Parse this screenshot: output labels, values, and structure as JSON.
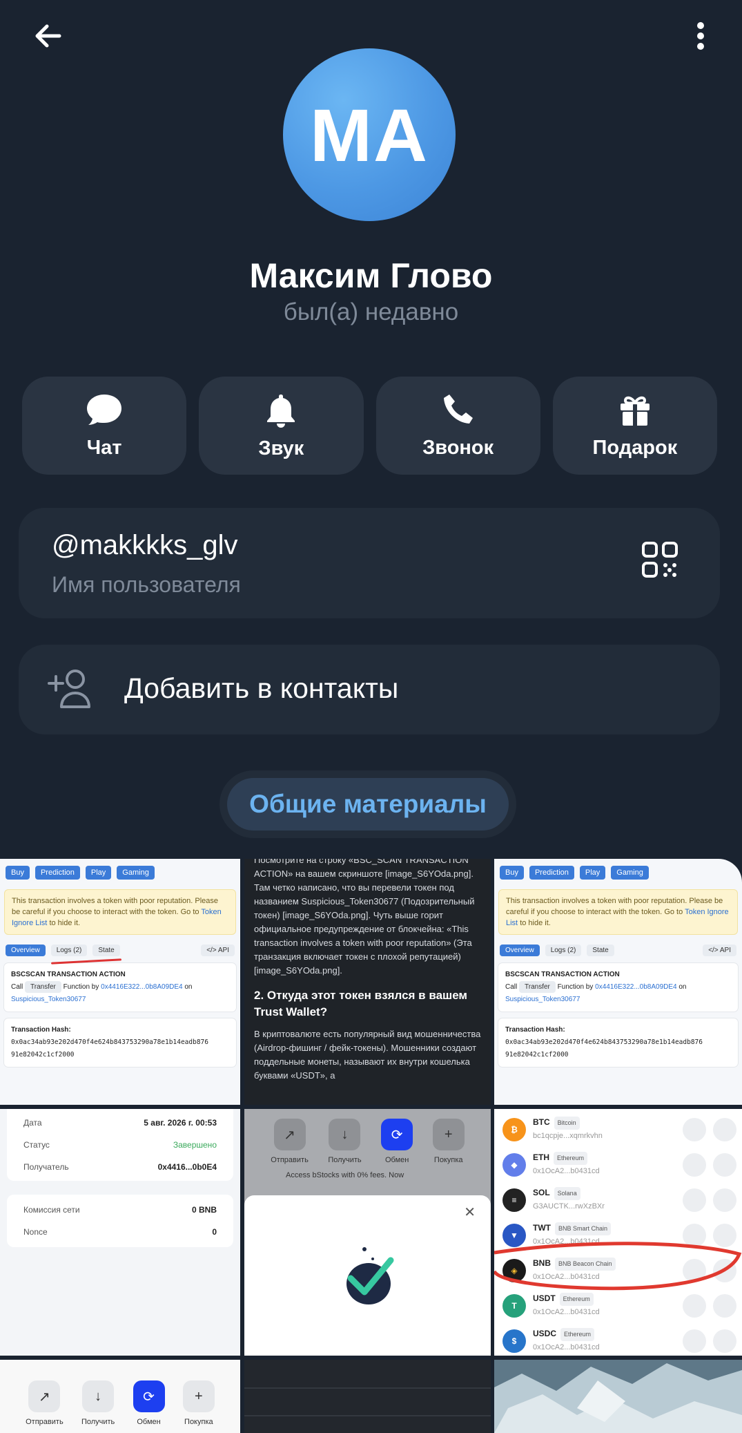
{
  "header": {
    "back_icon": "arrow-left-icon",
    "menu_icon": "more-vertical-icon"
  },
  "profile": {
    "initials": "МА",
    "name": "Максим Глово",
    "status": "был(а) недавно",
    "avatar_color": "#4d98e4"
  },
  "actions": [
    {
      "label": "Чат",
      "icon": "chat-bubble-icon"
    },
    {
      "label": "Звук",
      "icon": "bell-icon"
    },
    {
      "label": "Звонок",
      "icon": "phone-icon"
    },
    {
      "label": "Подарок",
      "icon": "gift-icon"
    }
  ],
  "username": {
    "value": "@makkkks_glv",
    "label": "Имя пользователя",
    "icon": "qr-code-icon"
  },
  "add_contact": {
    "label": "Добавить в контакты",
    "icon": "add-person-icon"
  },
  "media_tab": {
    "label": "Общие материалы",
    "accent": "#6cb3f0"
  },
  "media": {
    "bscscan": {
      "menu": [
        "Buy",
        "Prediction",
        "Play",
        "Gaming"
      ],
      "warning": "This transaction involves a token with poor reputation. Please be careful if you choose to interact with the token.",
      "warning_go": "Go to",
      "warning_link": "Token Ignore List",
      "warning_end": "to hide it.",
      "tabs": [
        "Overview",
        "Logs (2)",
        "State"
      ],
      "api": "</> API",
      "action_title": "BSCSCAN TRANSACTION ACTION",
      "call": "Call",
      "call_tag": "Transfer",
      "function_by": "Function by",
      "function_addr": "0x4416E322...0b8A09DE4",
      "on": "on",
      "token": "Suspicious_Token30677",
      "hash_title": "Transaction Hash:",
      "hash": "0x0ac34ab93e202d470f4e624b843753290a78e1b14eadb876 91e82042c1cf2000"
    },
    "article": {
      "p1": "Посмотрите на строку «BSC_SCAN TRANSACTION ACTION» на вашем скриншоте [image_S6YOda.png]. Там четко написано, что вы перевели токен под названием Suspicious_Token30677 (Подозрительный токен) [image_S6YOda.png]. Чуть выше горит официальное предупреждение от блокчейна: «This transaction involves a token with poor reputation» (Эта транзакция включает токен с плохой репутацией) [image_S6YOda.png].",
      "h2": "2. Откуда этот токен взялся в вашем Trust Wallet?",
      "p2": "В криптовалюте есть популярный вид мошенничества (Airdrop-фишинг / фейк-токены). Мошенники создают поддельные монеты, называют их внутри кошелька буквами «USDT», а"
    },
    "details": {
      "rows": [
        {
          "k": "Дата",
          "v": "5 авг. 2026 г. 00:53"
        },
        {
          "k": "Статус",
          "v": "Завершено"
        },
        {
          "k": "Получатель",
          "v": "0x4416...0b0E4"
        }
      ],
      "rows2": [
        {
          "k": "Комиссия сети",
          "v": "0 BNB"
        },
        {
          "k": "Nonce",
          "v": "0"
        }
      ]
    },
    "wallet_actions": [
      {
        "label": "Отправить",
        "icon": "arrow-up-right-icon"
      },
      {
        "label": "Получить",
        "icon": "arrow-down-icon"
      },
      {
        "label": "Обмен",
        "icon": "swap-icon"
      },
      {
        "label": "Покупка",
        "icon": "plus-icon"
      }
    ],
    "promo": "Access bStocks with 0% fees. Now",
    "coins": [
      {
        "sym": "BTC",
        "net": "Bitcoin",
        "addr": "bc1qcpje...xqmrkvhn",
        "color": "#f7931a"
      },
      {
        "sym": "ETH",
        "net": "Ethereum",
        "addr": "0x1OcA2...b0431cd",
        "color": "#627eea"
      },
      {
        "sym": "SOL",
        "net": "Solana",
        "addr": "G3AUCTK...rwXzBXr",
        "color": "#222222"
      },
      {
        "sym": "TWT",
        "net": "BNB Smart Chain",
        "addr": "0x1OcA2...b0431cd",
        "color": "#2957c4"
      },
      {
        "sym": "BNB",
        "net": "BNB Beacon Chain",
        "addr": "0x1OcA2...b0431cd",
        "color": "#1a1a1a"
      },
      {
        "sym": "USDT",
        "net": "Ethereum",
        "addr": "0x1OcA2...b0431cd",
        "color": "#26a17b"
      },
      {
        "sym": "USDC",
        "net": "Ethereum",
        "addr": "0x1OcA2...b0431cd",
        "color": "#2775ca"
      }
    ]
  }
}
